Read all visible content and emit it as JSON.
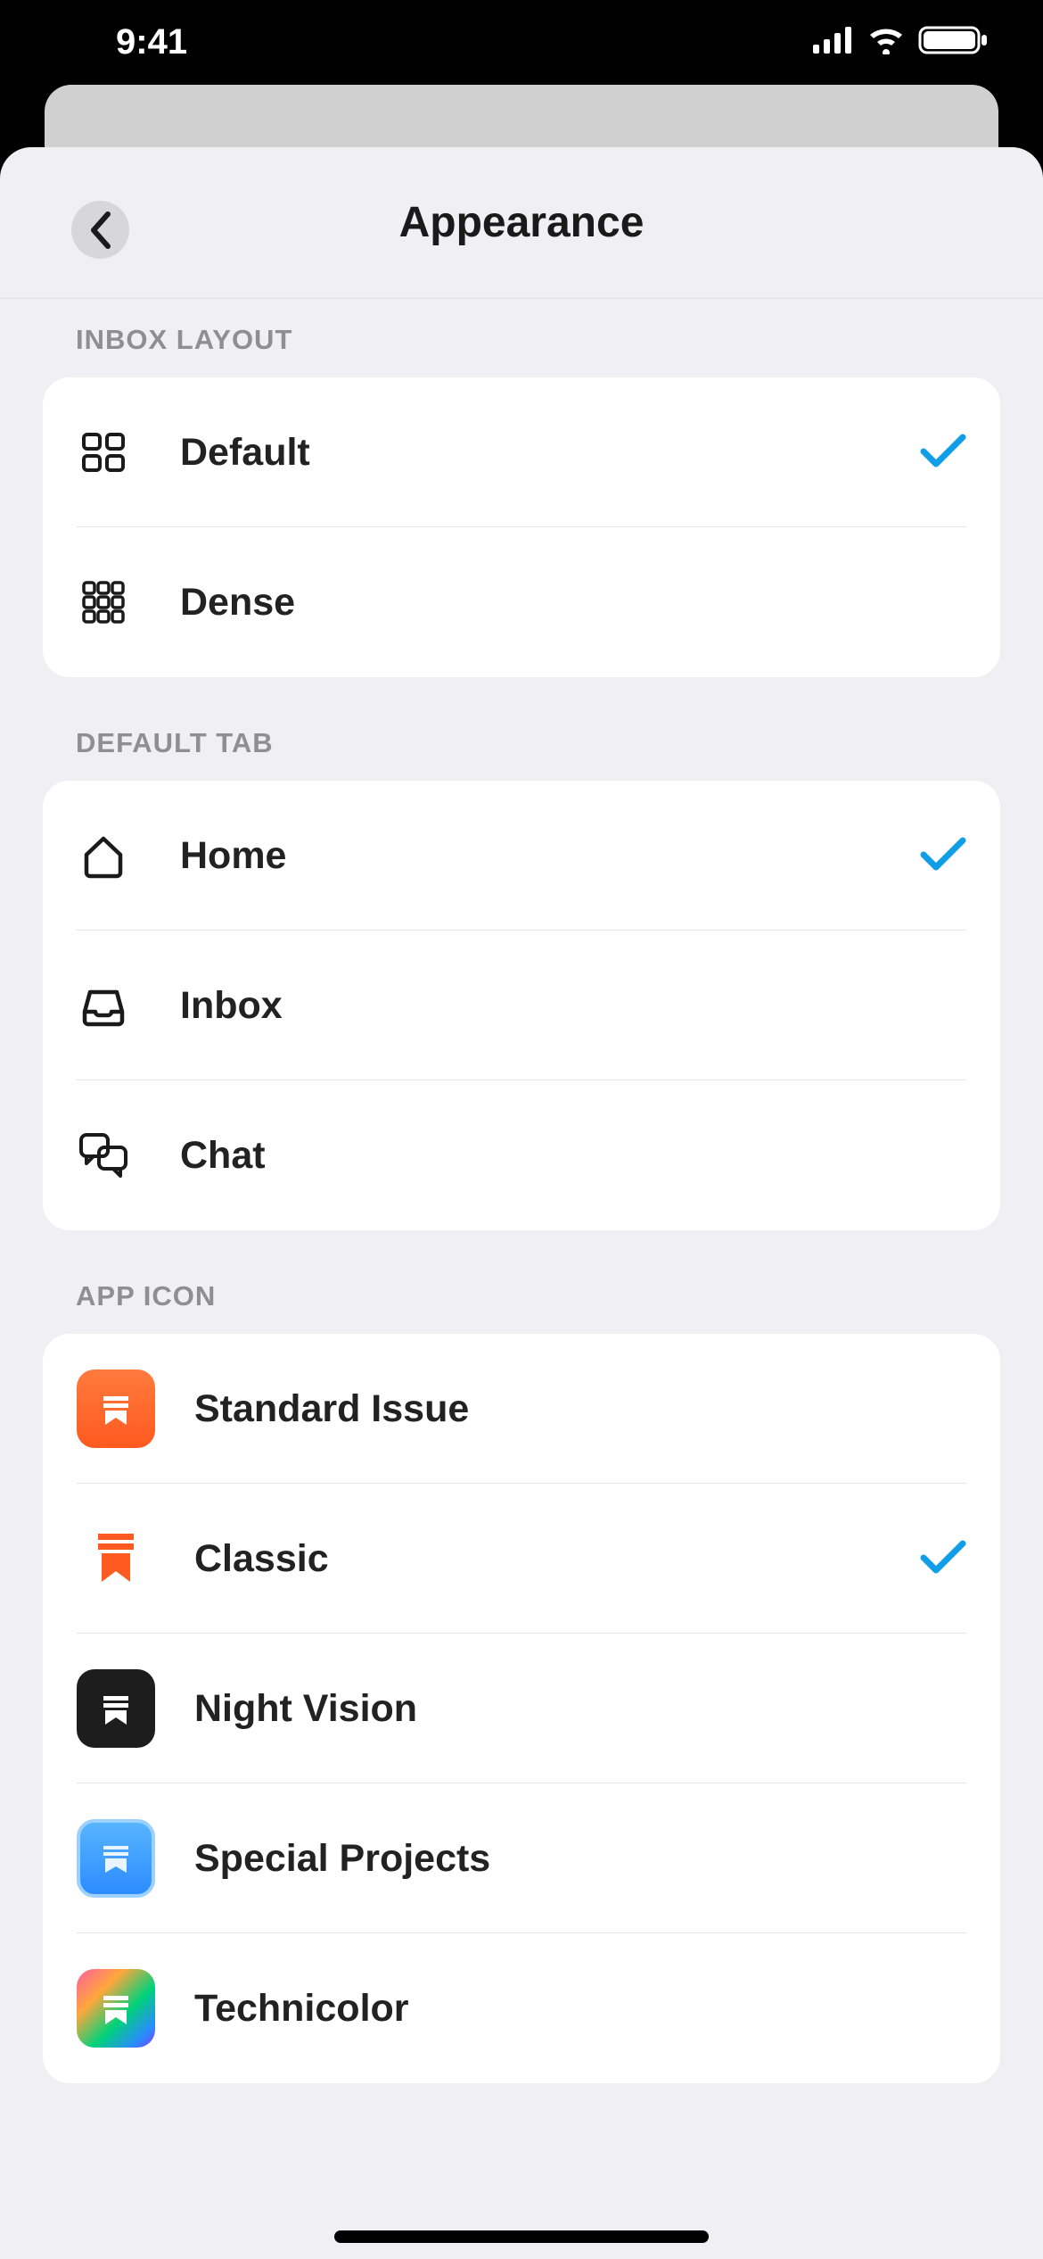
{
  "status": {
    "time": "9:41"
  },
  "nav": {
    "title": "Appearance"
  },
  "sections": {
    "inbox_layout": {
      "header": "INBOX LAYOUT",
      "items": [
        {
          "label": "Default",
          "selected": true
        },
        {
          "label": "Dense",
          "selected": false
        }
      ]
    },
    "default_tab": {
      "header": "DEFAULT TAB",
      "items": [
        {
          "label": "Home",
          "selected": true
        },
        {
          "label": "Inbox",
          "selected": false
        },
        {
          "label": "Chat",
          "selected": false
        }
      ]
    },
    "app_icon": {
      "header": "APP ICON",
      "items": [
        {
          "label": "Standard Issue",
          "selected": false
        },
        {
          "label": "Classic",
          "selected": true
        },
        {
          "label": "Night Vision",
          "selected": false
        },
        {
          "label": "Special Projects",
          "selected": false
        },
        {
          "label": "Technicolor",
          "selected": false
        }
      ]
    }
  }
}
